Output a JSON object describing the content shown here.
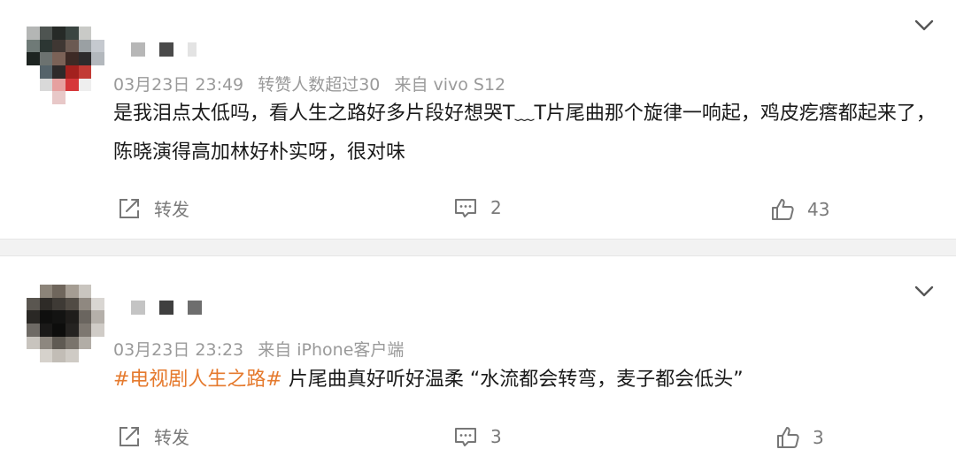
{
  "posts": [
    {
      "meta": {
        "date": "03月23日 23:49",
        "extra": "转赞人数超过30",
        "source": "来自 vivo S12"
      },
      "content": {
        "text": "是我泪点太低吗，看人生之路好多片段好想哭T﹏T片尾曲那个旋律一响起，鸡皮疙瘩都起来了，陈晓演得高加林好朴实呀，很对味"
      },
      "actions": {
        "repost_label": "转发",
        "comment_count": "2",
        "like_count": "43"
      }
    },
    {
      "meta": {
        "date": "03月23日 23:23",
        "source": "来自 iPhone客户端"
      },
      "content": {
        "hashtag": "#电视剧人生之路#",
        "text": " 片尾曲真好听好温柔 “水流都会转弯，麦子都会低头”"
      },
      "actions": {
        "repost_label": "转发",
        "comment_count": "3",
        "like_count": "3"
      }
    }
  ],
  "colors": {
    "hashtag": "#e57a2e",
    "meta": "#9a9a9a",
    "text": "#1a1a1a",
    "action": "#7a7a7a",
    "divider": "#f2f2f2"
  },
  "icons": [
    "chevron-down-icon",
    "repost-icon",
    "comment-icon",
    "like-icon"
  ]
}
